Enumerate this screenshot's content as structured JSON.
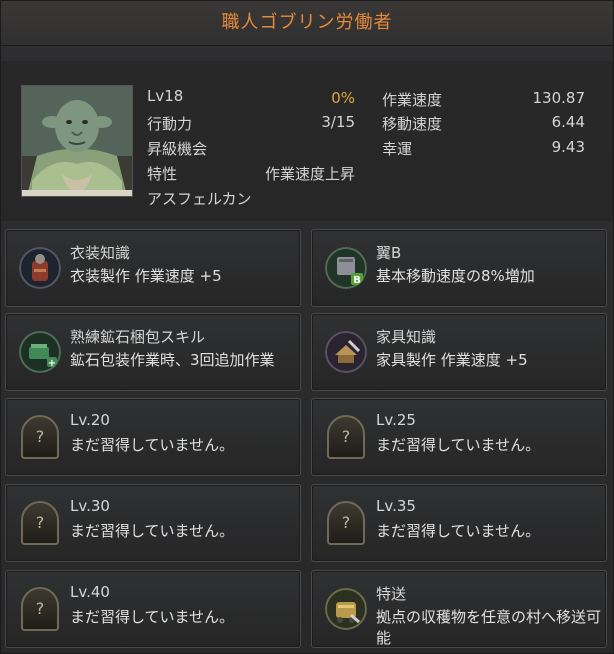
{
  "window": {
    "title": "職人ゴブリン労働者"
  },
  "profile": {
    "level": "Lv18",
    "exp_percent": "0%",
    "action_label": "行動力",
    "action_value": "3/15",
    "promotion_label": "昇級機会",
    "trait_label": "特性",
    "trait_value": "作業速度上昇",
    "hometown": "アスフェルカン",
    "stats": [
      {
        "label": "作業速度",
        "value": "130.87"
      },
      {
        "label": "移動速度",
        "value": "6.44"
      },
      {
        "label": "幸運",
        "value": "9.43"
      }
    ]
  },
  "skills": [
    {
      "title": "衣装知識",
      "desc": "衣装製作 作業速度 +5",
      "icon": "costume-knowledge-icon",
      "locked": false
    },
    {
      "title": "翼B",
      "desc": "基本移動速度の8%増加",
      "icon": "wings-b-icon",
      "locked": false
    },
    {
      "title": "熟練鉱石梱包スキル",
      "desc": "鉱石包装作業時、3回追加作業",
      "icon": "ore-packing-icon",
      "locked": false
    },
    {
      "title": "家具知識",
      "desc": "家具製作 作業速度 +5",
      "icon": "furniture-knowledge-icon",
      "locked": false
    },
    {
      "title": "Lv.20",
      "desc": "まだ習得していません。",
      "icon": "locked-skill-icon",
      "locked": true
    },
    {
      "title": "Lv.25",
      "desc": "まだ習得していません。",
      "icon": "locked-skill-icon",
      "locked": true
    },
    {
      "title": "Lv.30",
      "desc": "まだ習得していません。",
      "icon": "locked-skill-icon",
      "locked": true
    },
    {
      "title": "Lv.35",
      "desc": "まだ習得していません。",
      "icon": "locked-skill-icon",
      "locked": true
    },
    {
      "title": "Lv.40",
      "desc": "まだ習得していません。",
      "icon": "locked-skill-icon",
      "locked": true
    },
    {
      "title": "特送",
      "desc": "拠点の収穫物を任意の村へ移送可能",
      "icon": "special-delivery-icon",
      "locked": false
    }
  ],
  "locked_glyph": "?",
  "colors": {
    "title": "#e58a3a",
    "percent": "#e0a640"
  }
}
